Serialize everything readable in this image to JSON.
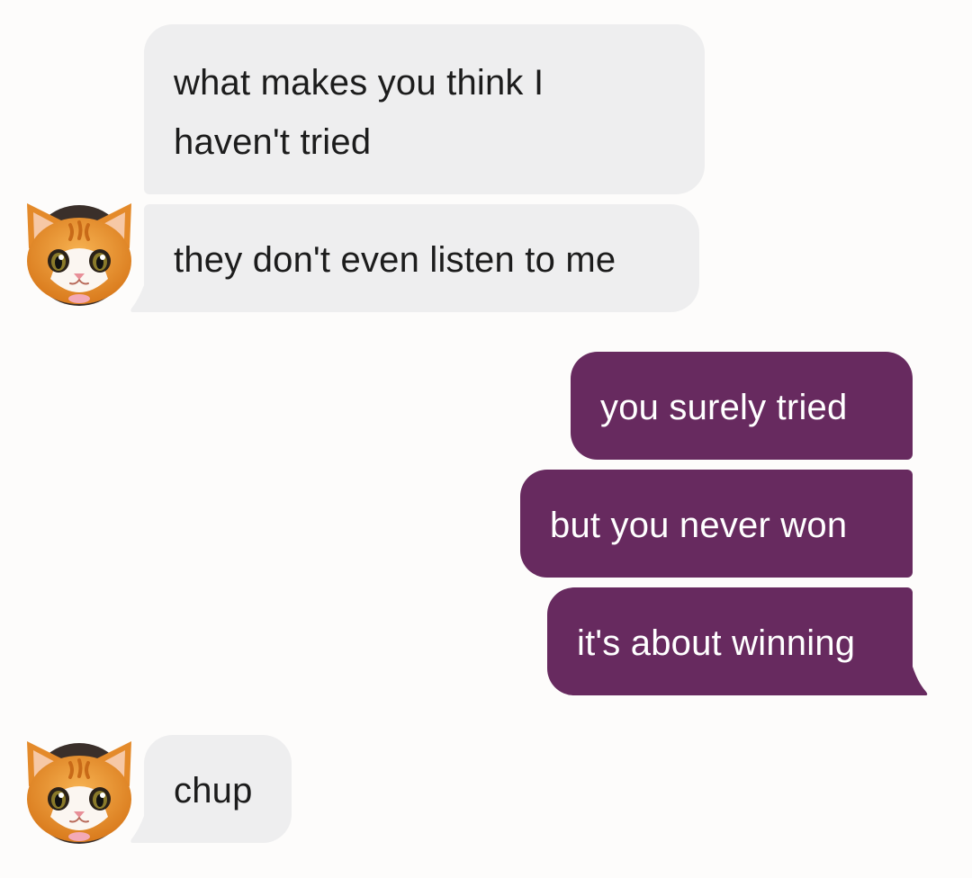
{
  "colors": {
    "background": "#fdfcfb",
    "incoming_bubble": "#eeeeef",
    "outgoing_bubble": "#672a5f",
    "incoming_text": "#1c1c1c",
    "outgoing_text": "#ffffff"
  },
  "contact": {
    "avatar_icon": "orange-kitten-avatar"
  },
  "messages": [
    {
      "direction": "incoming",
      "lines": [
        "what makes you think I",
        "haven't tried"
      ]
    },
    {
      "direction": "incoming",
      "lines": [
        "they don't even listen to me"
      ]
    },
    {
      "direction": "outgoing",
      "lines": [
        "you surely tried"
      ]
    },
    {
      "direction": "outgoing",
      "lines": [
        "but you never won"
      ]
    },
    {
      "direction": "outgoing",
      "lines": [
        "it's about winning"
      ]
    },
    {
      "direction": "incoming",
      "lines": [
        "chup"
      ]
    }
  ]
}
